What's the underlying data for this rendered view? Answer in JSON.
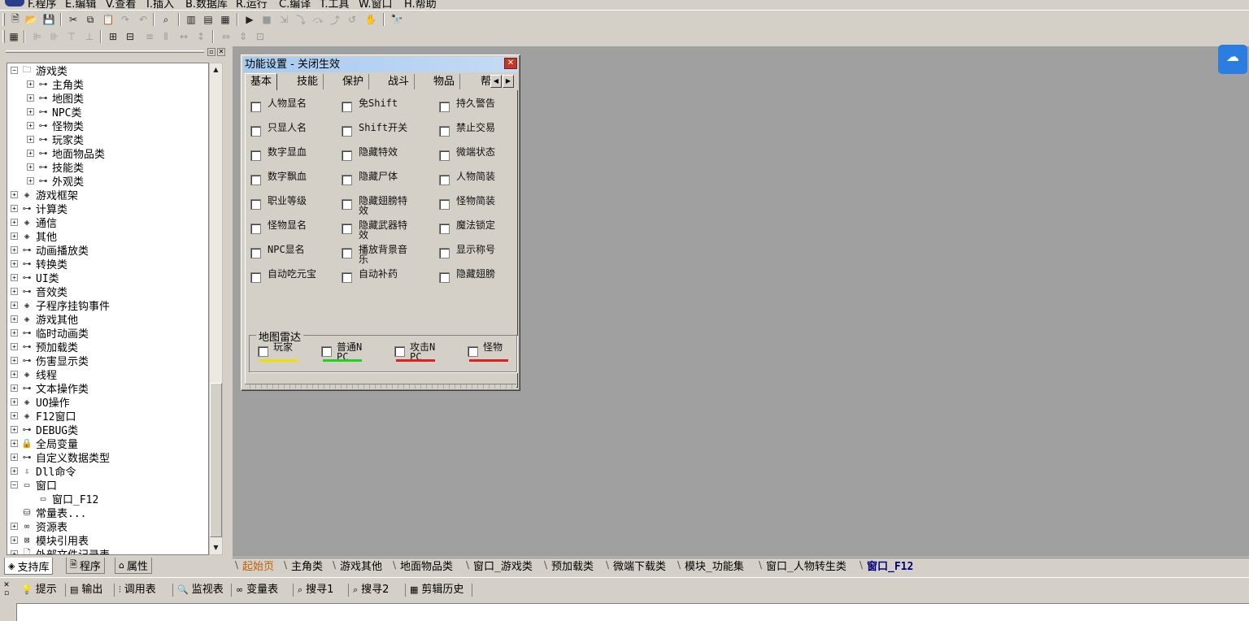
{
  "menu": [
    "F.程序",
    "E.编辑",
    "V.查看",
    "I.插入",
    "B.数据库",
    "R.运行",
    "C.编译",
    "T.工具",
    "W.窗口",
    "H.帮助"
  ],
  "toolbar1": [
    {
      "icon": "new-file-icon",
      "g": "🗎",
      "dis": false
    },
    {
      "icon": "open-folder-icon",
      "g": "📂",
      "dis": false
    },
    {
      "icon": "save-icon",
      "g": "💾",
      "dis": false
    },
    {
      "icon": "cut-icon",
      "g": "✂",
      "dis": false
    },
    {
      "icon": "copy-icon",
      "g": "⧉",
      "dis": false
    },
    {
      "icon": "paste-icon",
      "g": "📋",
      "dis": true
    },
    {
      "icon": "redo-icon",
      "g": "↷",
      "dis": true
    },
    {
      "icon": "undo-icon",
      "g": "↶",
      "dis": true
    },
    {
      "icon": "find-icon",
      "g": "⌕",
      "dis": false
    },
    {
      "icon": "layout-left-icon",
      "g": "▥",
      "dis": false
    },
    {
      "icon": "layout-top-icon",
      "g": "▤",
      "dis": false
    },
    {
      "icon": "layout-both-icon",
      "g": "▦",
      "dis": false
    },
    {
      "icon": "run-icon",
      "g": "▶",
      "dis": false
    },
    {
      "icon": "stop-icon",
      "g": "■",
      "dis": true
    },
    {
      "icon": "step-icon",
      "g": "⇲",
      "dis": true
    },
    {
      "icon": "step-into-icon",
      "g": "⤵",
      "dis": true
    },
    {
      "icon": "step-over-icon",
      "g": "⤼",
      "dis": true
    },
    {
      "icon": "step-out-icon",
      "g": "⤴",
      "dis": true
    },
    {
      "icon": "run-to-icon",
      "g": "↺",
      "dis": true
    },
    {
      "icon": "hand-icon",
      "g": "✋",
      "dis": true
    },
    {
      "icon": "binoculars-icon",
      "g": "🔭",
      "dis": false
    }
  ],
  "toolbar2": [
    {
      "icon": "calculator-icon",
      "g": "▦",
      "dis": false
    },
    {
      "icon": "align-left-icon",
      "g": "⊫",
      "dis": true
    },
    {
      "icon": "align-right-icon",
      "g": "⊪",
      "dis": true
    },
    {
      "icon": "align-top-icon",
      "g": "⊤",
      "dis": true
    },
    {
      "icon": "align-bottom-icon",
      "g": "⊥",
      "dis": true
    },
    {
      "icon": "center-horizontal-icon",
      "g": "⊞",
      "dis": false
    },
    {
      "icon": "center-vertical-icon",
      "g": "⊟",
      "dis": false
    },
    {
      "icon": "space-horizontal-icon",
      "g": "≡",
      "dis": true
    },
    {
      "icon": "space-vertical-icon",
      "g": "⫴",
      "dis": true
    },
    {
      "icon": "same-width-icon",
      "g": "↔",
      "dis": true
    },
    {
      "icon": "same-height-icon",
      "g": "↕",
      "dis": true
    },
    {
      "icon": "size-width-icon",
      "g": "⇔",
      "dis": true
    },
    {
      "icon": "size-height-icon",
      "g": "⇕",
      "dis": true
    },
    {
      "icon": "size-both-icon",
      "g": "⊡",
      "dis": true
    }
  ],
  "tree": [
    {
      "label": "游戏类",
      "icon": "folder-icon",
      "g": "🗀",
      "level": 0,
      "toggle": "−"
    },
    {
      "label": "主角类",
      "icon": "class-icon",
      "g": "⊶",
      "level": 1,
      "toggle": "+"
    },
    {
      "label": "地图类",
      "icon": "class-icon",
      "g": "⊶",
      "level": 1,
      "toggle": "+"
    },
    {
      "label": "NPC类",
      "icon": "class-icon",
      "g": "⊶",
      "level": 1,
      "toggle": "+"
    },
    {
      "label": "怪物类",
      "icon": "class-icon",
      "g": "⊶",
      "level": 1,
      "toggle": "+"
    },
    {
      "label": "玩家类",
      "icon": "class-icon",
      "g": "⊶",
      "level": 1,
      "toggle": "+"
    },
    {
      "label": "地面物品类",
      "icon": "class-icon",
      "g": "⊶",
      "level": 1,
      "toggle": "+"
    },
    {
      "label": "技能类",
      "icon": "class-icon",
      "g": "⊶",
      "level": 1,
      "toggle": "+"
    },
    {
      "label": "外观类",
      "icon": "class-icon",
      "g": "⊶",
      "level": 1,
      "toggle": "+"
    },
    {
      "label": "游戏框架",
      "icon": "module-icon",
      "g": "◈",
      "level": 0,
      "toggle": "+"
    },
    {
      "label": "计算类",
      "icon": "class-icon",
      "g": "⊶",
      "level": 0,
      "toggle": "+"
    },
    {
      "label": "通信",
      "icon": "module-icon",
      "g": "◈",
      "level": 0,
      "toggle": "+"
    },
    {
      "label": "其他",
      "icon": "module-icon",
      "g": "◈",
      "level": 0,
      "toggle": "+"
    },
    {
      "label": "动画播放类",
      "icon": "class-icon",
      "g": "⊶",
      "level": 0,
      "toggle": "+"
    },
    {
      "label": "转换类",
      "icon": "class-icon",
      "g": "⊶",
      "level": 0,
      "toggle": "+"
    },
    {
      "label": "UI类",
      "icon": "class-icon",
      "g": "⊶",
      "level": 0,
      "toggle": "+"
    },
    {
      "label": "音效类",
      "icon": "class-icon",
      "g": "⊶",
      "level": 0,
      "toggle": "+"
    },
    {
      "label": "子程序挂钩事件",
      "icon": "module-icon",
      "g": "◈",
      "level": 0,
      "toggle": "+"
    },
    {
      "label": "游戏其他",
      "icon": "module-icon",
      "g": "◈",
      "level": 0,
      "toggle": "+"
    },
    {
      "label": "临时动画类",
      "icon": "class-icon",
      "g": "⊶",
      "level": 0,
      "toggle": "+"
    },
    {
      "label": "预加载类",
      "icon": "class-icon",
      "g": "⊶",
      "level": 0,
      "toggle": "+"
    },
    {
      "label": "伤害显示类",
      "icon": "class-icon",
      "g": "⊶",
      "level": 0,
      "toggle": "+"
    },
    {
      "label": "线程",
      "icon": "module-icon",
      "g": "◈",
      "level": 0,
      "toggle": "+"
    },
    {
      "label": "文本操作类",
      "icon": "class-icon",
      "g": "⊶",
      "level": 0,
      "toggle": "+"
    },
    {
      "label": "UO操作",
      "icon": "module-icon",
      "g": "◈",
      "level": 0,
      "toggle": "+"
    },
    {
      "label": "F12窗口",
      "icon": "module-icon",
      "g": "◈",
      "level": 0,
      "toggle": "+"
    },
    {
      "label": "DEBUG类",
      "icon": "class-icon",
      "g": "⊶",
      "level": 0,
      "toggle": "+"
    },
    {
      "label": "全局变量",
      "icon": "lock-icon",
      "g": "🔒",
      "level": 0,
      "toggle": "+"
    },
    {
      "label": "自定义数据类型",
      "icon": "class-icon",
      "g": "⊶",
      "level": 0,
      "toggle": "+"
    },
    {
      "label": "Dll命令",
      "icon": "dll-icon",
      "g": "⇩",
      "level": 0,
      "toggle": "+"
    },
    {
      "label": "窗口",
      "icon": "window-icon",
      "g": "▭",
      "level": 0,
      "toggle": "−"
    },
    {
      "label": "窗口_F12",
      "icon": "window-icon",
      "g": "▭",
      "level": 1,
      "toggle": ""
    },
    {
      "label": "常量表...",
      "icon": "constants-icon",
      "g": "⛁",
      "level": 0,
      "toggle": ""
    },
    {
      "label": "资源表",
      "icon": "resource-icon",
      "g": "∞",
      "level": 0,
      "toggle": "+"
    },
    {
      "label": "模块引用表",
      "icon": "module-ref-icon",
      "g": "⊠",
      "level": 0,
      "toggle": "+"
    },
    {
      "label": "外部文件记录表",
      "icon": "file-icon",
      "g": "🗋",
      "level": 0,
      "toggle": "+"
    }
  ],
  "panel_tabs": [
    {
      "label": "支持库",
      "icon": "library-icon",
      "g": "◈"
    },
    {
      "label": "程序",
      "icon": "program-icon",
      "g": "🗎"
    },
    {
      "label": "属性",
      "icon": "properties-icon",
      "g": "⌂"
    }
  ],
  "dialog": {
    "title": "功能设置 - 关闭生效",
    "close": "✕",
    "tabs": [
      "基本",
      "技能",
      "保护",
      "战斗",
      "物品",
      "帮"
    ],
    "columns": [
      [
        "人物显名",
        "只显人名",
        "数字显血",
        "数字飘血",
        "职业等级",
        "怪物显名",
        "NPC显名",
        "自动吃元宝"
      ],
      [
        "免Shift",
        "Shift开关",
        "隐藏特效",
        "隐藏尸体",
        "隐藏翅膀特效",
        "隐藏武器特效",
        "播放背景音乐",
        "自动补药"
      ],
      [
        "持久警告",
        "禁止交易",
        "微端状态",
        "人物简装",
        "怪物简装",
        "魔法锁定",
        "显示称号",
        "隐藏翅膀"
      ]
    ],
    "radar": {
      "title": "地图雷达",
      "items": [
        {
          "label": "玩家",
          "color": "#f0e000"
        },
        {
          "label": "普通NPC",
          "color": "#20d020"
        },
        {
          "label": "攻击NPC",
          "color": "#e02020"
        },
        {
          "label": "怪物",
          "color": "#e02020"
        }
      ]
    }
  },
  "window_tabs": [
    "起始页",
    "主角类",
    "游戏其他",
    "地面物品类",
    "窗口_游戏类",
    "预加载类",
    "微端下载类",
    "模块_功能集",
    "窗口_人物转生类",
    "窗口_F12"
  ],
  "bottom_tabs": [
    {
      "label": "提示",
      "icon": "hint-icon",
      "g": "💡"
    },
    {
      "label": "输出",
      "icon": "output-icon",
      "g": "▤"
    },
    {
      "label": "调用表",
      "icon": "call-table-icon",
      "g": "⫶"
    },
    {
      "label": "监视表",
      "icon": "watch-icon",
      "g": "🔍"
    },
    {
      "label": "变量表",
      "icon": "variables-icon",
      "g": "∞"
    },
    {
      "label": "搜寻1",
      "icon": "search-icon",
      "g": "⌕"
    },
    {
      "label": "搜寻2",
      "icon": "search-icon",
      "g": "⌕"
    },
    {
      "label": "剪辑历史",
      "icon": "clipboard-icon",
      "g": "▦"
    }
  ]
}
